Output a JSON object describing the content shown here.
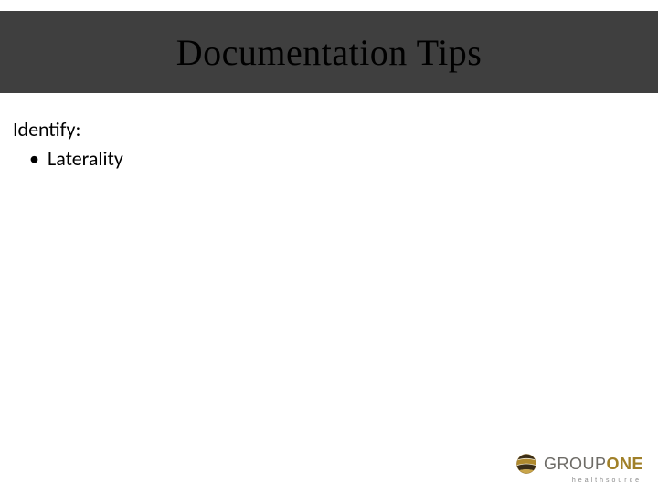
{
  "title": "Documentation Tips",
  "lead": "Identify:",
  "bullets": [
    "Laterality"
  ],
  "logo": {
    "group_text": "GROUP",
    "one_text": "ONE",
    "subtitle": "healthsource"
  },
  "colors": {
    "band": "#3f3f3f",
    "logo_group": "#6d6b66",
    "logo_one": "#a08028",
    "logo_sub": "#8a8a8a"
  }
}
